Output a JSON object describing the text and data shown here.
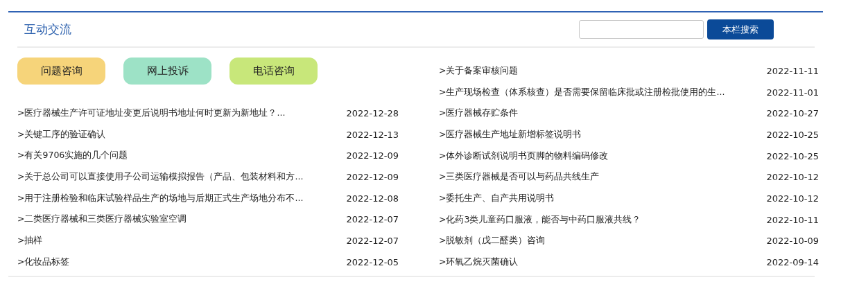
{
  "section": {
    "title": "互动交流"
  },
  "search": {
    "button": "本栏搜索"
  },
  "quick_buttons": [
    {
      "label": "问题咨询",
      "color": "#f6d47a"
    },
    {
      "label": "网上投诉",
      "color": "#9de2c6"
    },
    {
      "label": "电话咨询",
      "color": "#c8e77a"
    }
  ],
  "left_list": [
    {
      "title": ">医疗器械生产许可证地址变更后说明书地址何时更新为新地址？...",
      "date": "2022-12-28"
    },
    {
      "title": ">关键工序的验证确认",
      "date": "2022-12-13"
    },
    {
      "title": ">有关9706实施的几个问题",
      "date": "2022-12-09"
    },
    {
      "title": ">关于总公司可以直接使用子公司运输模拟报告（产品、包装材料和方...",
      "date": "2022-12-09"
    },
    {
      "title": ">用于注册检验和临床试验样品生产的场地与后期正式生产场地分布不...",
      "date": "2022-12-08"
    },
    {
      "title": ">二类医疗器械和三类医疗器械实验室空调",
      "date": "2022-12-07"
    },
    {
      "title": ">抽样",
      "date": "2022-12-07"
    },
    {
      "title": ">化妆品标签",
      "date": "2022-12-05"
    }
  ],
  "right_list": [
    {
      "title": ">关于备案审核问题",
      "date": "2022-11-11"
    },
    {
      "title": ">生产现场检查（体系核查）是否需要保留临床批或注册检批使用的生...",
      "date": "2022-11-01"
    },
    {
      "title": ">医疗器械存贮条件",
      "date": "2022-10-27"
    },
    {
      "title": ">医疗器械生产地址新增标签说明书",
      "date": "2022-10-25"
    },
    {
      "title": ">体外诊断试剂说明书页脚的物料编码修改",
      "date": "2022-10-25"
    },
    {
      "title": ">三类医疗器械是否可以与药品共线生产",
      "date": "2022-10-12"
    },
    {
      "title": ">委托生产、自产共用说明书",
      "date": "2022-10-12"
    },
    {
      "title": ">化药3类儿童药口服液，能否与中药口服液共线？",
      "date": "2022-10-11"
    },
    {
      "title": ">脱敏剂（戊二醛类）咨询",
      "date": "2022-10-09"
    },
    {
      "title": ">环氧乙烷灭菌确认",
      "date": "2022-09-14"
    }
  ]
}
